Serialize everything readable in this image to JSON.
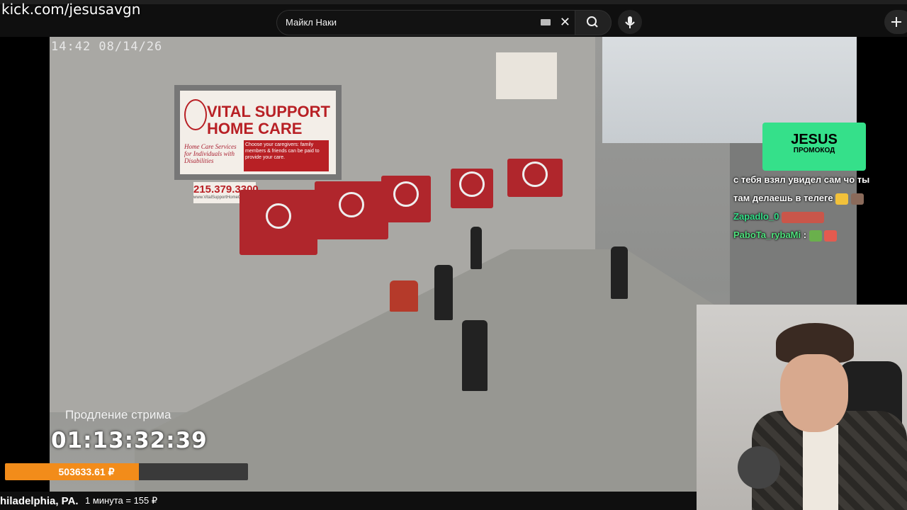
{
  "browser": {
    "url_overlay": "kick.com/jesusavgn",
    "search_query": "Майкл Наки",
    "icons": [
      "keyboard-icon",
      "clear-icon",
      "search-icon",
      "microphone-icon",
      "create-icon"
    ]
  },
  "stream": {
    "timestamp": "14:42 08/14/26",
    "sign_title": "VITAL SUPPORT\nHOME CARE",
    "sign_tagline": "Home Care Services for Individuals with Disabilities",
    "sign_note": "Choose your caregivers: family members & friends can be paid to provide your care.",
    "phone": "215.379.3300",
    "phone_site": "www.VitalSupportHomeCare.com"
  },
  "overlay": {
    "promo_title": "JESUS",
    "promo_sub": "ПРОМОКОД",
    "chat": [
      {
        "user": "",
        "text": "с тебя взял увидел сам чо ты"
      },
      {
        "user": "",
        "text": "там делаешь в телеге"
      },
      {
        "user": "Zapadlo_0",
        "text": ""
      },
      {
        "user": "PaboTa_rybaMi",
        "text": ":"
      }
    ],
    "extension_label": "Продление стрима",
    "timer": "01:13:32:39",
    "donation_amount": "503633.61 ₽",
    "donation_progress": 0.55,
    "location": "hiladelphia, PA.",
    "rate": "1 минута = 155 ₽"
  },
  "colors": {
    "accent_green": "#35e08a",
    "progress_orange": "#f28c1a",
    "awning_red": "#b0262c"
  }
}
